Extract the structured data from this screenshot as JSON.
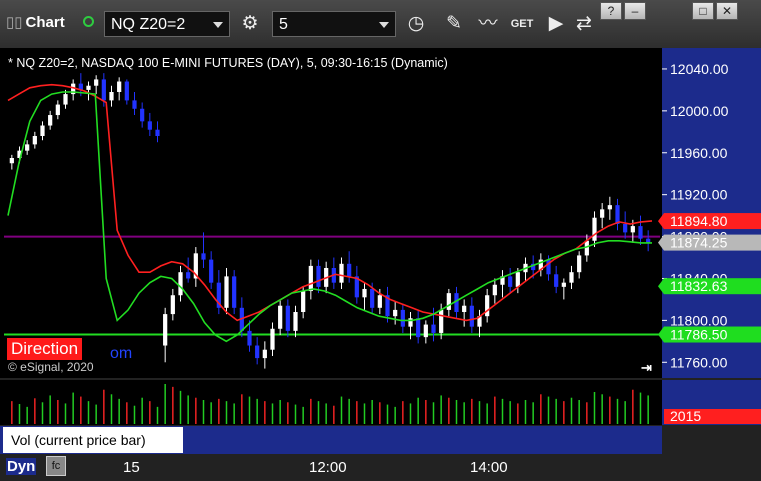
{
  "toolbar": {
    "app_title": "Chart",
    "symbol": "NQ Z20=2",
    "interval": "5",
    "icons": [
      "link-icon",
      "gear-icon",
      "clock-icon",
      "pencil-icon",
      "study-icon",
      "get-icon",
      "play-icon",
      "arrows-icon"
    ],
    "window_buttons": [
      "?",
      "–",
      "□",
      "✕"
    ],
    "get_label": "GET"
  },
  "study_title": "* NQ Z20=2, NASDAQ 100 E-MINI FUTURES (DAY), 5, 09:30-16:15 (Dynamic)",
  "direction_label": "Direction",
  "direction_tail": "om",
  "copyright": "© eSignal, 2020",
  "volume_pane": {
    "label": "Vol (current price bar)",
    "close_symbol": "x",
    "value_badge": "2015"
  },
  "time_axis": {
    "labels": [
      "15",
      "12:00",
      "14:00"
    ],
    "dyn_label": "Dyn",
    "dyn_icon": "fc"
  },
  "price_axis": {
    "ticks": [
      "12040.00",
      "12000.00",
      "11960.00",
      "11920.00",
      "11880.00",
      "11840.00",
      "11800.00",
      "11760.00"
    ],
    "badges": [
      {
        "text": "11894.80",
        "color": "#ff1f1f",
        "value": 11894.8
      },
      {
        "text": "11874.25",
        "color": "#b8b8b8",
        "value": 11874.25
      },
      {
        "text": "11832.63",
        "color": "#1fdd1f",
        "value": 11832.63
      },
      {
        "text": "11786.50",
        "color": "#1fdd1f",
        "value": 11786.5
      }
    ]
  },
  "colors": {
    "up": "#ffffff",
    "down": "#2233ff",
    "ma_red": "#ff2020",
    "ma_green": "#22dd22",
    "ma_purple": "#a070d0",
    "level": "#800080"
  },
  "chart_data": {
    "type": "candlestick",
    "ylim": [
      11745,
      12060
    ],
    "horizontal_levels": [
      {
        "name": "",
        "value": 11880,
        "color": "#800080"
      },
      {
        "name": "",
        "value": 11786.5,
        "color": "#22dd22"
      }
    ],
    "candles": [
      [
        11950,
        11958,
        11944,
        11955
      ],
      [
        11955,
        11966,
        11950,
        11962
      ],
      [
        11962,
        11972,
        11958,
        11968
      ],
      [
        11968,
        11980,
        11964,
        11976
      ],
      [
        11976,
        11990,
        11972,
        11986
      ],
      [
        11986,
        12000,
        11982,
        11996
      ],
      [
        11996,
        12010,
        11992,
        12006
      ],
      [
        12006,
        12020,
        12002,
        12016
      ],
      [
        12016,
        12030,
        12010,
        12026
      ],
      [
        12026,
        12036,
        12014,
        12020
      ],
      [
        12020,
        12028,
        12010,
        12024
      ],
      [
        12024,
        12034,
        12016,
        12030
      ],
      [
        12030,
        12036,
        12004,
        12010
      ],
      [
        12010,
        12024,
        12004,
        12018
      ],
      [
        12018,
        12032,
        12010,
        12028
      ],
      [
        12028,
        12030,
        12006,
        12010
      ],
      [
        12010,
        12018,
        11996,
        12002
      ],
      [
        12002,
        12008,
        11984,
        11990
      ],
      [
        11990,
        11998,
        11976,
        11982
      ],
      [
        11982,
        11990,
        11970,
        11976
      ],
      [
        11776,
        11812,
        11760,
        11806
      ],
      [
        11806,
        11830,
        11800,
        11824
      ],
      [
        11824,
        11852,
        11818,
        11846
      ],
      [
        11846,
        11860,
        11836,
        11840
      ],
      [
        11840,
        11870,
        11832,
        11864
      ],
      [
        11864,
        11884,
        11850,
        11858
      ],
      [
        11858,
        11866,
        11830,
        11836
      ],
      [
        11836,
        11848,
        11806,
        11812
      ],
      [
        11812,
        11850,
        11806,
        11842
      ],
      [
        11842,
        11848,
        11806,
        11812
      ],
      [
        11812,
        11822,
        11784,
        11790
      ],
      [
        11790,
        11800,
        11770,
        11776
      ],
      [
        11776,
        11784,
        11758,
        11764
      ],
      [
        11764,
        11780,
        11754,
        11772
      ],
      [
        11772,
        11798,
        11766,
        11792
      ],
      [
        11792,
        11820,
        11786,
        11814
      ],
      [
        11814,
        11820,
        11784,
        11790
      ],
      [
        11790,
        11814,
        11784,
        11808
      ],
      [
        11808,
        11832,
        11802,
        11828
      ],
      [
        11828,
        11858,
        11820,
        11852
      ],
      [
        11852,
        11858,
        11826,
        11832
      ],
      [
        11832,
        11856,
        11826,
        11850
      ],
      [
        11850,
        11860,
        11830,
        11836
      ],
      [
        11836,
        11860,
        11830,
        11854
      ],
      [
        11854,
        11866,
        11836,
        11842
      ],
      [
        11842,
        11852,
        11816,
        11822
      ],
      [
        11822,
        11836,
        11810,
        11830
      ],
      [
        11830,
        11836,
        11806,
        11812
      ],
      [
        11812,
        11830,
        11806,
        11824
      ],
      [
        11824,
        11832,
        11798,
        11804
      ],
      [
        11804,
        11818,
        11796,
        11810
      ],
      [
        11810,
        11816,
        11788,
        11794
      ],
      [
        11794,
        11808,
        11782,
        11802
      ],
      [
        11802,
        11810,
        11778,
        11784
      ],
      [
        11784,
        11800,
        11778,
        11796
      ],
      [
        11796,
        11812,
        11780,
        11788
      ],
      [
        11788,
        11816,
        11782,
        11810
      ],
      [
        11810,
        11830,
        11804,
        11826
      ],
      [
        11826,
        11832,
        11802,
        11808
      ],
      [
        11808,
        11820,
        11794,
        11814
      ],
      [
        11814,
        11822,
        11788,
        11794
      ],
      [
        11794,
        11810,
        11784,
        11804
      ],
      [
        11804,
        11830,
        11798,
        11824
      ],
      [
        11824,
        11840,
        11816,
        11834
      ],
      [
        11834,
        11848,
        11822,
        11842
      ],
      [
        11842,
        11850,
        11826,
        11832
      ],
      [
        11832,
        11850,
        11826,
        11846
      ],
      [
        11846,
        11860,
        11838,
        11854
      ],
      [
        11854,
        11862,
        11840,
        11848
      ],
      [
        11848,
        11864,
        11842,
        11858
      ],
      [
        11858,
        11862,
        11838,
        11844
      ],
      [
        11844,
        11852,
        11826,
        11832
      ],
      [
        11832,
        11840,
        11820,
        11836
      ],
      [
        11836,
        11852,
        11830,
        11846
      ],
      [
        11846,
        11866,
        11840,
        11862
      ],
      [
        11862,
        11882,
        11856,
        11876
      ],
      [
        11876,
        11904,
        11870,
        11898
      ],
      [
        11898,
        11912,
        11888,
        11906
      ],
      [
        11906,
        11918,
        11896,
        11910
      ],
      [
        11910,
        11916,
        11886,
        11892
      ],
      [
        11892,
        11904,
        11878,
        11884
      ],
      [
        11884,
        11896,
        11874,
        11890
      ],
      [
        11890,
        11900,
        11872,
        11878
      ],
      [
        11878,
        11886,
        11866,
        11874
      ]
    ],
    "moving_averages": [
      {
        "name": "",
        "color": "#ff2020",
        "values": [
          12010,
          12016,
          12022,
          12024,
          12025,
          12024,
          12022,
          12019,
          12014,
          12008,
          11886,
          11862,
          11846,
          11846,
          11852,
          11856,
          11854,
          11846,
          11834,
          11820,
          11808,
          11800,
          11804,
          11808,
          11814,
          11820,
          11826,
          11832,
          11836,
          11840,
          11844,
          11842,
          11840,
          11834,
          11826,
          11820,
          11816,
          11812,
          11808,
          11806,
          11804,
          11802,
          11800,
          11802,
          11810,
          11818,
          11826,
          11834,
          11842,
          11850,
          11858,
          11864,
          11868,
          11876,
          11884,
          11890,
          11894,
          11892,
          11894,
          11895
        ]
      },
      {
        "name": "",
        "color": "#22dd22",
        "values": [
          11900,
          11950,
          11990,
          12010,
          12016,
          12018,
          12018,
          12017,
          12016,
          11840,
          11800,
          11810,
          11826,
          11836,
          11842,
          11840,
          11830,
          11816,
          11798,
          11786,
          11780,
          11786,
          11796,
          11806,
          11814,
          11820,
          11826,
          11828,
          11830,
          11828,
          11824,
          11818,
          11812,
          11808,
          11804,
          11802,
          11800,
          11800,
          11802,
          11806,
          11812,
          11818,
          11824,
          11830,
          11836,
          11840,
          11844,
          11848,
          11852,
          11856,
          11860,
          11864,
          11868,
          11870,
          11874,
          11876,
          11876,
          11875,
          11874,
          11874
        ]
      }
    ],
    "volume": [
      40,
      35,
      30,
      45,
      38,
      50,
      42,
      36,
      55,
      48,
      40,
      34,
      60,
      52,
      44,
      38,
      32,
      46,
      40,
      30,
      70,
      65,
      58,
      50,
      46,
      42,
      38,
      44,
      40,
      36,
      52,
      48,
      44,
      40,
      36,
      42,
      38,
      34,
      30,
      44,
      40,
      36,
      32,
      48,
      44,
      40,
      36,
      42,
      38,
      34,
      30,
      40,
      36,
      46,
      42,
      38,
      50,
      46,
      42,
      38,
      44,
      40,
      36,
      48,
      44,
      40,
      36,
      42,
      38,
      52,
      48,
      44,
      40,
      46,
      42,
      38,
      56,
      52,
      48,
      44,
      40,
      60,
      55,
      50
    ],
    "title": "",
    "xlabel": "",
    "ylabel": ""
  }
}
